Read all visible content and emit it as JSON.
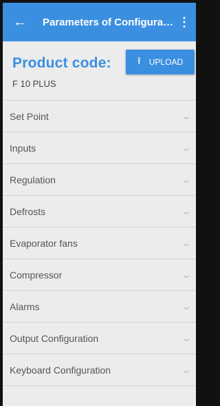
{
  "appbar": {
    "title": "Parameters of Configurat…",
    "back_icon": "arrow-left-icon",
    "more_icon": "more-vertical-icon"
  },
  "product": {
    "label": "Product code:",
    "value": "F 10 PLUS"
  },
  "upload": {
    "label": "UPLOAD",
    "icon": "upload-icon"
  },
  "sections": [
    {
      "label": "Set Point"
    },
    {
      "label": "Inputs"
    },
    {
      "label": "Regulation"
    },
    {
      "label": "Defrosts"
    },
    {
      "label": "Evaporator fans"
    },
    {
      "label": "Compressor"
    },
    {
      "label": "Alarms"
    },
    {
      "label": "Output Configuration"
    },
    {
      "label": "Keyboard Configuration"
    }
  ],
  "colors": {
    "accent": "#3b8fe0",
    "background": "#ececec"
  }
}
